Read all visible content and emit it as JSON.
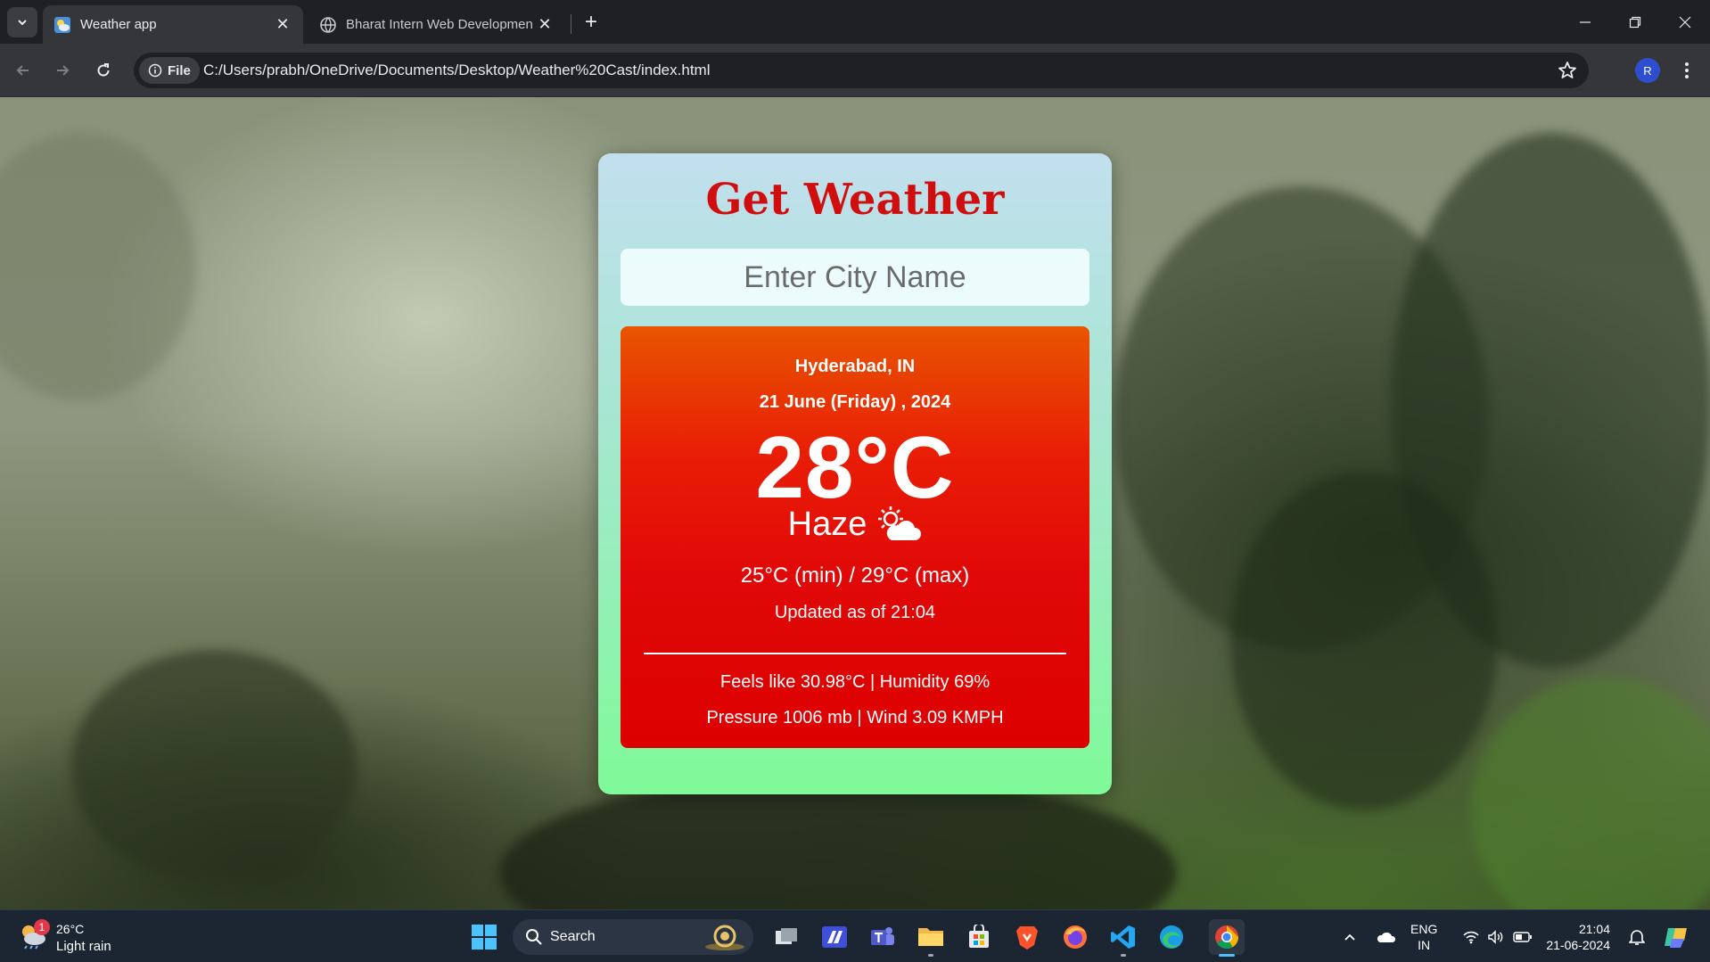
{
  "browser": {
    "tabs": [
      {
        "title": "Weather app",
        "active": true
      },
      {
        "title": "Bharat Intern Web Developmen",
        "active": false
      }
    ],
    "address": {
      "chip_label": "File",
      "url": "C:/Users/prabh/OneDrive/Documents/Desktop/Weather%20Cast/index.html"
    },
    "profile_initial": "R"
  },
  "app": {
    "heading": "Get Weather",
    "city_input": {
      "placeholder": "Enter City Name",
      "value": ""
    },
    "weather": {
      "location": "Hyderabad, IN",
      "date": "21 June (Friday) , 2024",
      "temperature": "28°C",
      "condition": "Haze",
      "condition_icon": "sun-behind-cloud-icon",
      "min_max": "25°C (min) / 29°C (max)",
      "updated": "Updated as of 21:04",
      "feels_humidity": "Feels like 30.98°C | Humidity 69%",
      "pressure_wind": "Pressure 1006 mb | Wind 3.09 KMPH"
    },
    "colors": {
      "heading": "#d10e0e",
      "card_top": "#c2dfee",
      "card_bottom": "#7ffa98",
      "result_top": "#e85500",
      "result_bottom": "#dd0000"
    }
  },
  "taskbar": {
    "weather_widget": {
      "badge": "1",
      "temp": "26°C",
      "desc": "Light rain"
    },
    "search_label": "Search",
    "pinned": [
      "windows-start-icon",
      "search-icon",
      "task-view-icon",
      "app-icon",
      "teams-icon",
      "file-explorer-icon",
      "microsoft-store-icon",
      "brave-icon",
      "firefox-icon",
      "vscode-icon",
      "edge-icon",
      "chrome-icon"
    ],
    "lang_top": "ENG",
    "lang_bottom": "IN",
    "time": "21:04",
    "date": "21-06-2024"
  }
}
